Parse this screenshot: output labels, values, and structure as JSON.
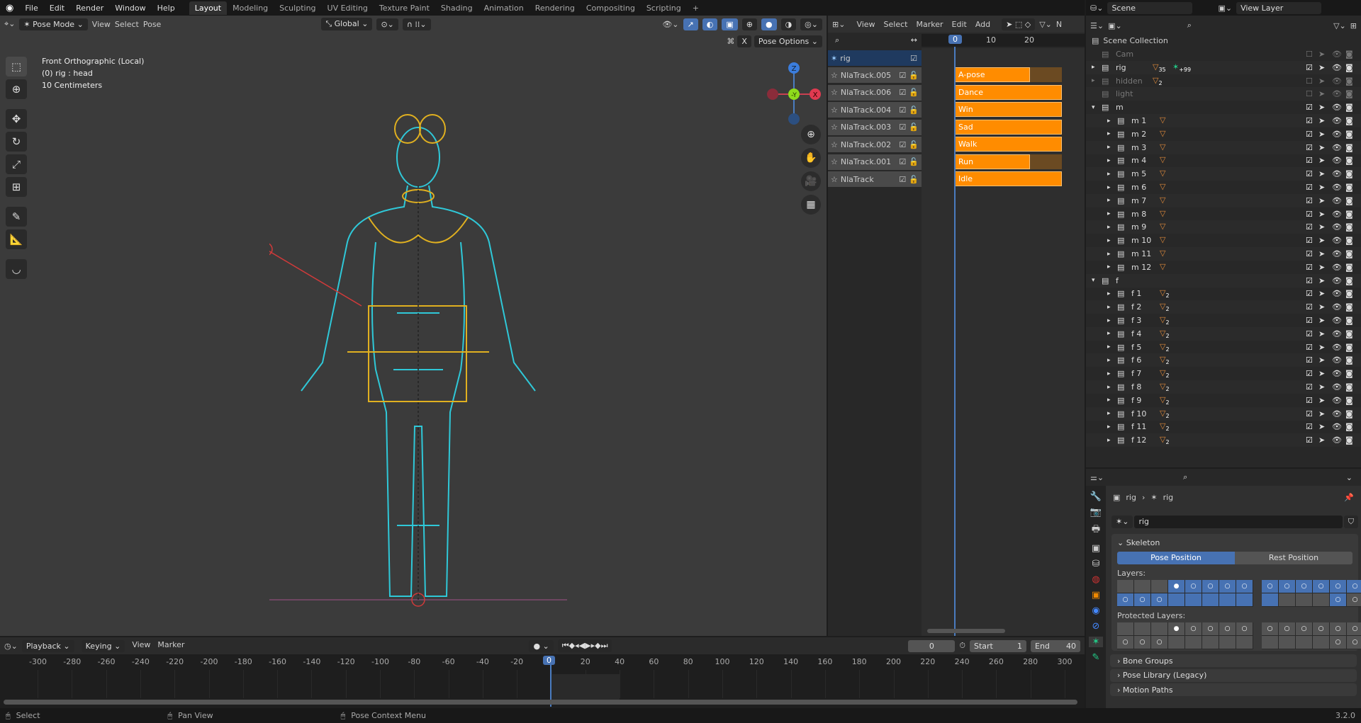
{
  "topbar": {
    "menus": [
      "File",
      "Edit",
      "Render",
      "Window",
      "Help"
    ],
    "workspaces": [
      "Layout",
      "Modeling",
      "Sculpting",
      "UV Editing",
      "Texture Paint",
      "Shading",
      "Animation",
      "Rendering",
      "Compositing",
      "Scripting"
    ],
    "active_workspace": "Layout",
    "add": "+"
  },
  "viewport": {
    "mode": "Pose Mode",
    "menus": [
      "View",
      "Select",
      "Pose"
    ],
    "orientation": "Global",
    "pose_options": "Pose Options",
    "x_mirror": "X",
    "info": {
      "view": "Front Orthographic (Local)",
      "object": "(0) rig : head",
      "scale": "10 Centimeters"
    },
    "gizmo": {
      "z": "Z",
      "y": "-Y",
      "x": "X"
    }
  },
  "nla": {
    "menus": [
      "View",
      "Select",
      "Marker",
      "Edit",
      "Add"
    ],
    "truncated": "N",
    "ruler": [
      "0",
      "10",
      "20"
    ],
    "current_frame": "0",
    "object": "rig",
    "tracks": [
      {
        "name": "NlaTrack.005",
        "strip": "A-pose",
        "full": false
      },
      {
        "name": "NlaTrack.006",
        "strip": "Dance",
        "full": true
      },
      {
        "name": "NlaTrack.004",
        "strip": "Win",
        "full": true
      },
      {
        "name": "NlaTrack.003",
        "strip": "Sad",
        "full": true
      },
      {
        "name": "NlaTrack.002",
        "strip": "Walk",
        "full": true
      },
      {
        "name": "NlaTrack.001",
        "strip": "Run",
        "full": false
      },
      {
        "name": "NlaTrack",
        "strip": "Idle",
        "full": true
      }
    ]
  },
  "outliner": {
    "scene": "Scene",
    "view_layer": "View Layer",
    "root": "Scene Collection",
    "rows": [
      {
        "name": "Cam",
        "level": 1,
        "dim": true,
        "checked": false
      },
      {
        "name": "rig",
        "level": 1,
        "expand": "▸",
        "checked": true,
        "badge1": "35",
        "badge2": "+99"
      },
      {
        "name": "hidden",
        "level": 1,
        "expand": "▸",
        "dim": true,
        "checked": false,
        "badge1": "2"
      },
      {
        "name": "light",
        "level": 1,
        "dim": true,
        "checked": false
      },
      {
        "name": "m",
        "level": 1,
        "expand": "▾",
        "checked": true
      },
      {
        "name": "m 1",
        "level": 2,
        "expand": "▸",
        "checked": true,
        "tri": ""
      },
      {
        "name": "m 2",
        "level": 2,
        "expand": "▸",
        "checked": true,
        "tri": ""
      },
      {
        "name": "m 3",
        "level": 2,
        "expand": "▸",
        "checked": true,
        "tri": ""
      },
      {
        "name": "m 4",
        "level": 2,
        "expand": "▸",
        "checked": true,
        "tri": ""
      },
      {
        "name": "m 5",
        "level": 2,
        "expand": "▸",
        "checked": true,
        "tri": ""
      },
      {
        "name": "m 6",
        "level": 2,
        "expand": "▸",
        "checked": true,
        "tri": ""
      },
      {
        "name": "m 7",
        "level": 2,
        "expand": "▸",
        "checked": true,
        "tri": ""
      },
      {
        "name": "m 8",
        "level": 2,
        "expand": "▸",
        "checked": true,
        "tri": ""
      },
      {
        "name": "m 9",
        "level": 2,
        "expand": "▸",
        "checked": true,
        "tri": ""
      },
      {
        "name": "m 10",
        "level": 2,
        "expand": "▸",
        "checked": true,
        "tri": ""
      },
      {
        "name": "m 11",
        "level": 2,
        "expand": "▸",
        "checked": true,
        "tri": ""
      },
      {
        "name": "m 12",
        "level": 2,
        "expand": "▸",
        "checked": true,
        "tri": ""
      },
      {
        "name": "f",
        "level": 1,
        "expand": "▾",
        "checked": true
      },
      {
        "name": "f 1",
        "level": 2,
        "expand": "▸",
        "checked": true,
        "tri": "2"
      },
      {
        "name": "f 2",
        "level": 2,
        "expand": "▸",
        "checked": true,
        "tri": "2"
      },
      {
        "name": "f 3",
        "level": 2,
        "expand": "▸",
        "checked": true,
        "tri": "2"
      },
      {
        "name": "f 4",
        "level": 2,
        "expand": "▸",
        "checked": true,
        "tri": "2"
      },
      {
        "name": "f 5",
        "level": 2,
        "expand": "▸",
        "checked": true,
        "tri": "2"
      },
      {
        "name": "f 6",
        "level": 2,
        "expand": "▸",
        "checked": true,
        "tri": "2"
      },
      {
        "name": "f 7",
        "level": 2,
        "expand": "▸",
        "checked": true,
        "tri": "2"
      },
      {
        "name": "f 8",
        "level": 2,
        "expand": "▸",
        "checked": true,
        "tri": "2"
      },
      {
        "name": "f 9",
        "level": 2,
        "expand": "▸",
        "checked": true,
        "tri": "2"
      },
      {
        "name": "f 10",
        "level": 2,
        "expand": "▸",
        "checked": true,
        "tri": "2"
      },
      {
        "name": "f 11",
        "level": 2,
        "expand": "▸",
        "checked": true,
        "tri": "2"
      },
      {
        "name": "f 12",
        "level": 2,
        "expand": "▸",
        "checked": true,
        "tri": "2"
      }
    ]
  },
  "properties": {
    "breadcrumb_object": "rig",
    "breadcrumb_data": "rig",
    "data_name": "rig",
    "skeleton": "Skeleton",
    "pose_position": "Pose Position",
    "rest_position": "Rest Position",
    "layers_label": "Layers:",
    "protected_label": "Protected Layers:",
    "layers": [
      [
        "eeeDOOOO",
        "OOOBBBBB"
      ],
      [
        "OOOOOOOO",
        "BeeeOooo"
      ]
    ],
    "protected": [
      [
        "eeedoooo",
        "oooeeeee"
      ],
      [
        "oooooooo",
        "eeeeoooo"
      ]
    ],
    "panels": [
      "Bone Groups",
      "Pose Library (Legacy)",
      "Motion Paths"
    ]
  },
  "timeline": {
    "menus": [
      "Playback",
      "Keying",
      "View",
      "Marker"
    ],
    "current_frame": "0",
    "start_label": "Start",
    "start": "1",
    "end_label": "End",
    "end": "40",
    "ticks": [
      "-300",
      "-280",
      "-260",
      "-240",
      "-220",
      "-200",
      "-180",
      "-160",
      "-140",
      "-120",
      "-100",
      "-80",
      "-60",
      "-40",
      "-20",
      "0",
      "20",
      "40",
      "60",
      "80",
      "100",
      "120",
      "140",
      "160",
      "180",
      "200",
      "220",
      "240",
      "260",
      "280",
      "300"
    ]
  },
  "status": {
    "select": "Select",
    "pan": "Pan View",
    "context": "Pose Context Menu",
    "version": "3.2.0"
  }
}
